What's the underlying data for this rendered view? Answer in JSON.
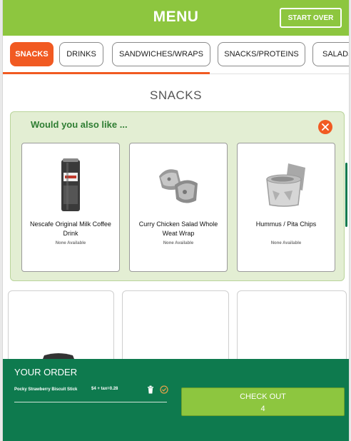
{
  "header": {
    "title": "MENU",
    "start_over_label": "START OVER"
  },
  "tabs": [
    {
      "label": "SNACKS",
      "active": true
    },
    {
      "label": "DRINKS",
      "active": false
    },
    {
      "label": "SANDWICHES/WRAPS",
      "active": false
    },
    {
      "label": "SNACKS/PROTEINS",
      "active": false
    },
    {
      "label": "SALADS",
      "active": false
    }
  ],
  "section_title": "SNACKS",
  "upsell": {
    "title": "Would you also like ...",
    "items": [
      {
        "name": "Nescafe Original Milk Coffee Drink",
        "availability": "None Available",
        "icon": "coffee-can-icon"
      },
      {
        "name": "Curry Chicken Salad Whole Weat Wrap",
        "availability": "None Available",
        "icon": "wrap-icon"
      },
      {
        "name": "Hummus / Pita Chips",
        "availability": "None Available",
        "icon": "hummus-cup-icon"
      }
    ]
  },
  "order": {
    "title": "YOUR ORDER",
    "items": [
      {
        "name": "Pocky Strawberry Biscuit Stick",
        "price": "$4 + tax=0.28"
      }
    ],
    "checkout_label": "CHECK OUT",
    "checkout_count": "4"
  },
  "colors": {
    "brand_green": "#8dc63f",
    "accent_orange": "#f15a22",
    "order_green": "#0e7a4e"
  }
}
